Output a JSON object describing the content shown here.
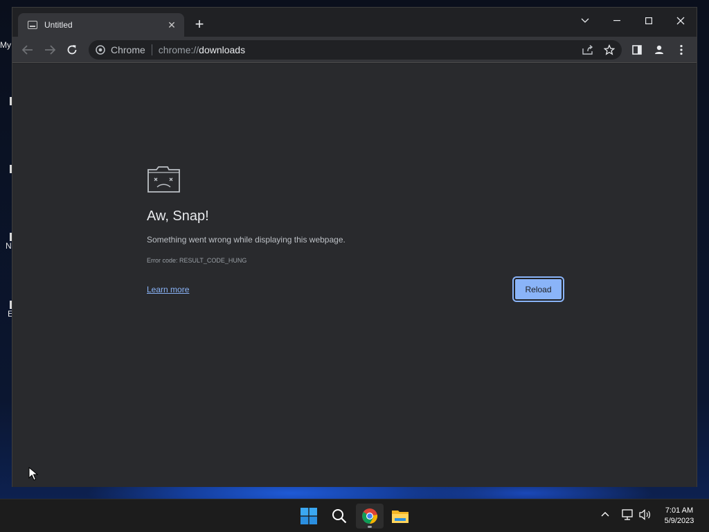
{
  "desktop": {
    "icons": [
      {
        "label": "My"
      },
      {
        "label": "N"
      },
      {
        "label": "E"
      }
    ]
  },
  "tab": {
    "title": "Untitled",
    "close_glyph": "✕",
    "new_tab_glyph": "+"
  },
  "toolbar": {
    "chip_label": "Chrome",
    "url_scheme": "chrome://",
    "url_host": "downloads"
  },
  "error_page": {
    "title": "Aw, Snap!",
    "message": "Something went wrong while displaying this webpage.",
    "error_code": "Error code: RESULT_CODE_HUNG",
    "learn_more": "Learn more",
    "reload": "Reload"
  },
  "taskbar": {
    "time": "7:01 AM",
    "date": "5/9/2023"
  },
  "colors": {
    "accent": "#8ab4f8",
    "page_bg": "#292a2d",
    "toolbar_bg": "#35363a",
    "frame_bg": "#202124"
  }
}
